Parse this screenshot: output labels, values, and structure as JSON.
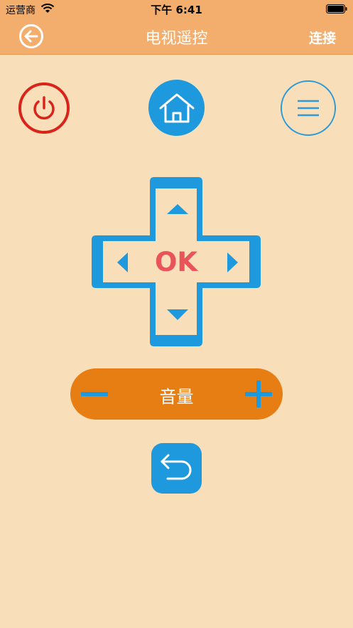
{
  "status_bar": {
    "carrier": "运营商",
    "time": "下午 6:41"
  },
  "nav": {
    "title": "电视遥控",
    "connect_label": "连接"
  },
  "remote": {
    "ok_label": "OK",
    "volume_label": "音量"
  },
  "colors": {
    "header": "#f3ad6c",
    "background": "#f9dfb9",
    "power": "#d9241b",
    "blue": "#1e99de",
    "volume": "#e77e13",
    "ok_text": "#e8545a"
  }
}
